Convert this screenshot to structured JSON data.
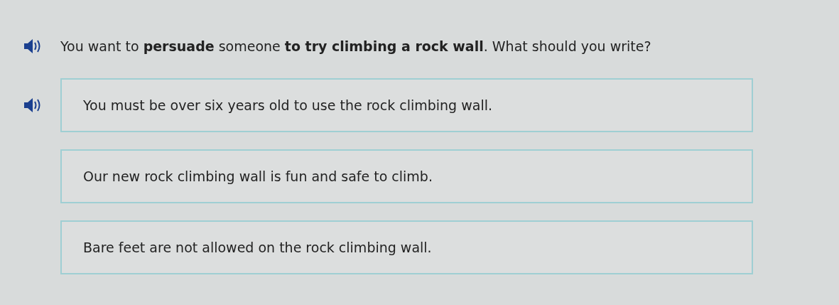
{
  "question": {
    "text": "You want to **persuade** someone **to try climbing a rock wall**. What should you write?",
    "audio": true
  },
  "options": [
    {
      "text": "You must be over six years old to use the rock climbing wall.",
      "audio": true
    },
    {
      "text": "Our new rock climbing wall is fun and safe to climb.",
      "audio": false
    },
    {
      "text": "Bare feet are not allowed on the rock climbing wall.",
      "audio": false
    }
  ]
}
